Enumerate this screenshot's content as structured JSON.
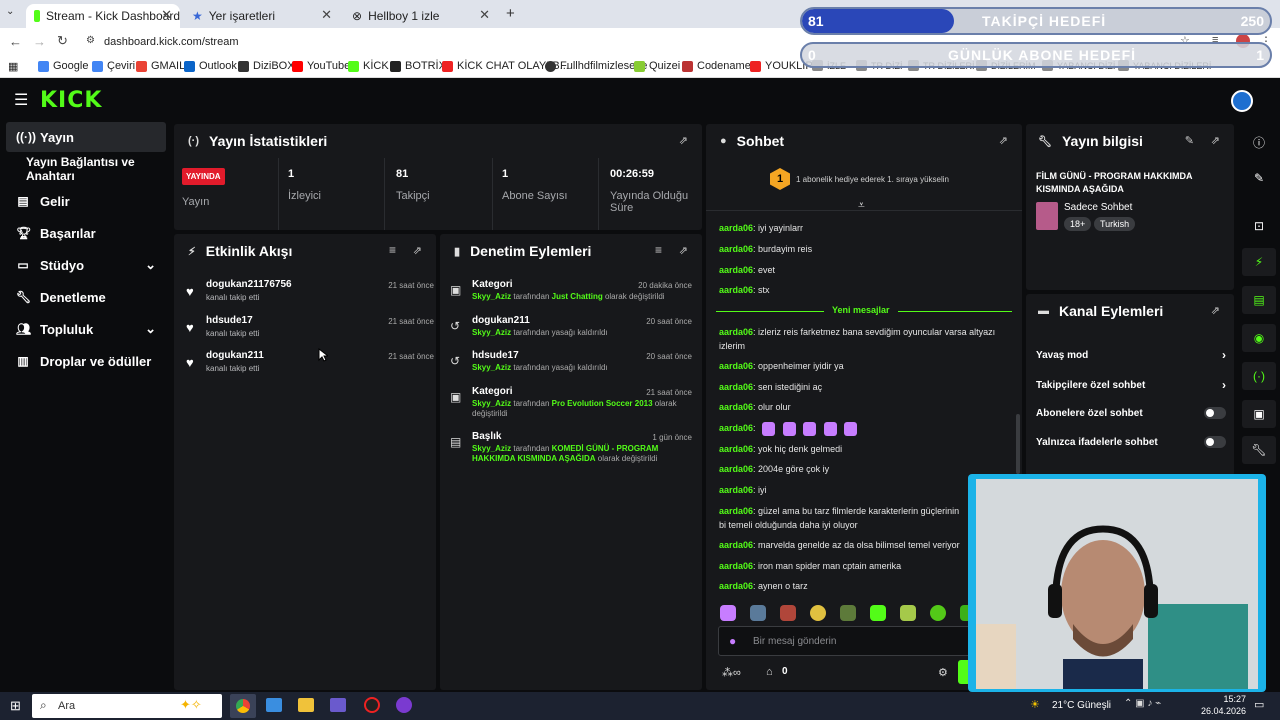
{
  "browser": {
    "tabs": [
      {
        "label": "Stream - Kick Dashboard"
      },
      {
        "label": "Yer işaretleri"
      },
      {
        "label": "Hellboy 1 izle"
      }
    ],
    "url": "dashboard.kick.com/stream",
    "bookmarks": [
      "Google",
      "Çeviri",
      "GMAIL",
      "Outlook",
      "DiziBOX",
      "YouTube",
      "KİCK",
      "BOTRİX",
      "KİCK CHAT OLAYI B...",
      "Fullhdfilmizlesene",
      "Quizei",
      "Codenames",
      "YOUKLİP2",
      "İZLE",
      "TR DİZİ",
      "TR DİZİLERİ",
      "DİZİLERİM",
      "YABANCI DİZİ",
      "YABANCI DİZİLERİ"
    ]
  },
  "overlay": {
    "follow_goal": "TAKİPÇİ HEDEFİ",
    "follow_current": "81",
    "follow_target": "250",
    "sub_goal": "GÜNLÜK ABONE HEDEFİ",
    "sub_current": "0",
    "sub_target": "1",
    "follow_progress": 0.324
  },
  "sidebar": {
    "items": [
      {
        "label": "Yayın"
      },
      {
        "label": "Yayın Bağlantısı ve Anahtarı"
      },
      {
        "label": "Gelir"
      },
      {
        "label": "Başarılar"
      },
      {
        "label": "Stüdyo"
      },
      {
        "label": "Denetleme"
      },
      {
        "label": "Topluluk"
      },
      {
        "label": "Droplar ve ödüller"
      }
    ]
  },
  "stats": {
    "title": "Yayın İstatistikleri",
    "badge": "YAYINDA",
    "live_label": "Yayın",
    "items": [
      {
        "value": "1",
        "label": "İzleyici"
      },
      {
        "value": "81",
        "label": "Takipçi"
      },
      {
        "value": "1",
        "label": "Abone Sayısı"
      },
      {
        "value": "00:26:59",
        "label": "Yayında Olduğu Süre"
      }
    ]
  },
  "activity": {
    "title": "Etkinlik Akışı",
    "items": [
      {
        "name": "dogukan21176756",
        "sub": "kanalı takip etti",
        "time": "21 saat önce"
      },
      {
        "name": "hdsude17",
        "sub": "kanalı takip etti",
        "time": "21 saat önce"
      },
      {
        "name": "dogukan211",
        "sub": "kanalı takip etti",
        "time": "21 saat önce"
      }
    ]
  },
  "moderation": {
    "title": "Denetim Eylemleri",
    "items": [
      {
        "title": "Kategori",
        "user": "Skyy_Aziz",
        "mid": " tarafından ",
        "target": "Just Chatting",
        "end": " olarak değiştirildi",
        "time": "20 dakika önce"
      },
      {
        "title": "dogukan211",
        "user": "Skyy_Aziz",
        "mid": " tarafından yasağı kaldırıldı",
        "target": "",
        "end": "",
        "time": "20 saat önce"
      },
      {
        "title": "hdsude17",
        "user": "Skyy_Aziz",
        "mid": " tarafından yasağı kaldırıldı",
        "target": "",
        "end": "",
        "time": "20 saat önce"
      },
      {
        "title": "Kategori",
        "user": "Skyy_Aziz",
        "mid": " tarafından ",
        "target": "Pro Evolution Soccer 2013",
        "end": " olarak değiştirildi",
        "time": "21 saat önce"
      },
      {
        "title": "Başlık",
        "user": "Skyy_Aziz",
        "mid": " tarafından ",
        "target": "KOMEDİ GÜNÜ - PROGRAM HAKKIMDA KISMINDA AŞAĞIDA",
        "end": " olarak değiştirildi",
        "time": "1 gün önce"
      }
    ]
  },
  "chat": {
    "title": "Sohbet",
    "gift_rank": "1",
    "gift_text": "1 abonelik hediye ederek 1. sıraya yükselin",
    "new_messages": "Yeni mesajlar",
    "input_placeholder": "Bir mesaj gönderin",
    "points": "0",
    "messages": [
      {
        "user": "aarda06",
        "text": "iyi yayinlarr"
      },
      {
        "user": "aarda06",
        "text": "burdayim reis"
      },
      {
        "user": "aarda06",
        "text": "evet"
      },
      {
        "user": "aarda06",
        "text": "stx"
      },
      {
        "user": "aarda06",
        "text": "izleriz reis farketmez bana sevdiğim oyuncular varsa altyazı"
      },
      {
        "user": "",
        "text": "izlerim"
      },
      {
        "user": "aarda06",
        "text": "oppenheimer iyidir ya"
      },
      {
        "user": "aarda06",
        "text": "sen istediğini aç"
      },
      {
        "user": "aarda06",
        "text": "olur olur"
      },
      {
        "user": "aarda06",
        "text": ""
      },
      {
        "user": "aarda06",
        "text": "yok hiç denk gelmedi"
      },
      {
        "user": "aarda06",
        "text": "2004e göre çok iy"
      },
      {
        "user": "aarda06",
        "text": "iyi"
      },
      {
        "user": "aarda06",
        "text": "güzel ama bu tarz filmlerde karakterlerin güçlerinin"
      },
      {
        "user": "",
        "text": "bi temeli olduğunda daha iyi oluyor"
      },
      {
        "user": "aarda06",
        "text": "marvelda genelde az da olsa bilimsel temel veriyor"
      },
      {
        "user": "aarda06",
        "text": "iron man spider man cptain amerika"
      },
      {
        "user": "aarda06",
        "text": "aynen o tarz"
      }
    ]
  },
  "info": {
    "title": "Yayın bilgisi",
    "stream_title": "FİLM GÜNÜ - PROGRAM HAKKIMDA KISMINDA AŞAĞIDA",
    "category": "Sadece Sohbet",
    "tags": [
      "18+",
      "Turkish"
    ]
  },
  "channel": {
    "title": "Kanal Eylemleri",
    "items": [
      {
        "label": "Yavaş mod",
        "kind": "arrow"
      },
      {
        "label": "Takipçilere özel sohbet",
        "kind": "arrow"
      },
      {
        "label": "Abonelere özel sohbet",
        "kind": "toggle"
      },
      {
        "label": "Yalnızca ifadelerle sohbet",
        "kind": "toggle"
      }
    ]
  },
  "taskbar": {
    "search": "Ara",
    "weather": "21°C  Güneşli",
    "time": "15:27",
    "date": "26.04.2026"
  },
  "colors": {
    "accent": "#53fc18",
    "live": "#e21b2b",
    "bg": "#0b0c0e",
    "panel": "#17181b"
  }
}
